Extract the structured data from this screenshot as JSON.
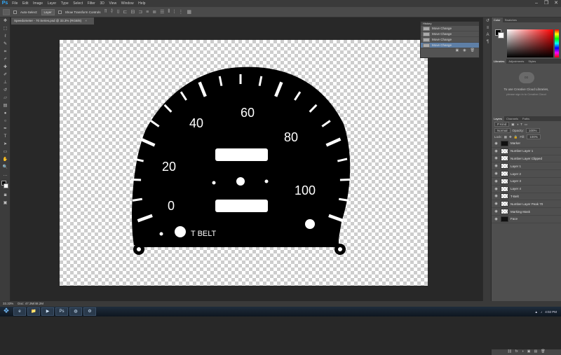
{
  "app": {
    "logo": "Ps",
    "menu": [
      "File",
      "Edit",
      "Image",
      "Layer",
      "Type",
      "Select",
      "Filter",
      "3D",
      "View",
      "Window",
      "Help"
    ],
    "window_controls": [
      "–",
      "❐",
      "✕"
    ]
  },
  "options": {
    "auto_select_label": "Auto-Select:",
    "auto_select_value": "Layer",
    "show_transform": "Show Transform Controls"
  },
  "document": {
    "tab_title": "Speedometer - 70 Series.psd @ 33.3% (RGB/8)",
    "close": "×"
  },
  "gauge": {
    "labels": [
      "0",
      "20",
      "40",
      "60",
      "80",
      "100"
    ],
    "belt_label": "T BELT"
  },
  "history": {
    "tabs": [
      "History"
    ],
    "rows": [
      "Move Change",
      "Move Change",
      "Move Change",
      "Move Change"
    ],
    "selected": 3
  },
  "color_panel": {
    "tabs": [
      "Color",
      "Swatches"
    ],
    "foreground": "#000000",
    "background": "#ffffff"
  },
  "libraries": {
    "tabs": [
      "Libraries",
      "Adjustments",
      "Styles"
    ],
    "title": "To use Creative Cloud Libraries,",
    "subtitle": "please sign in to Creative Cloud"
  },
  "layers": {
    "tabs": [
      "Layers",
      "Channels",
      "Paths"
    ],
    "kind_label": "P Kind",
    "blend": "Normal",
    "opacity_label": "Opacity:",
    "opacity": "100%",
    "lock_label": "Lock:",
    "fill_label": "Fill:",
    "fill": "100%",
    "items": [
      {
        "name": "Marker",
        "dark": true
      },
      {
        "name": "Number Layer 1",
        "dark": false
      },
      {
        "name": "Number Layer Clipped",
        "dark": false
      },
      {
        "name": "Layer 1",
        "dark": false
      },
      {
        "name": "Layer 2",
        "dark": false
      },
      {
        "name": "Layer 3",
        "dark": false
      },
      {
        "name": "Layer 4",
        "dark": false
      },
      {
        "name": "T-Belt",
        "dark": false
      },
      {
        "name": "Number Layer Peak 70",
        "dark": false
      },
      {
        "name": "Marking Mask",
        "dark": false
      },
      {
        "name": "Face",
        "dark": true
      }
    ],
    "footer_icons": [
      "⛓",
      "fx",
      "◑",
      "▣",
      "▤",
      "🗑"
    ]
  },
  "status": {
    "zoom": "33.33%",
    "doc": "Doc: 47.3M/48.2M"
  },
  "taskbar": {
    "start": "❖",
    "apps": [
      "e",
      "📁",
      "▶",
      "Ps",
      "◍",
      "⚙"
    ],
    "time": "4:02 PM"
  }
}
